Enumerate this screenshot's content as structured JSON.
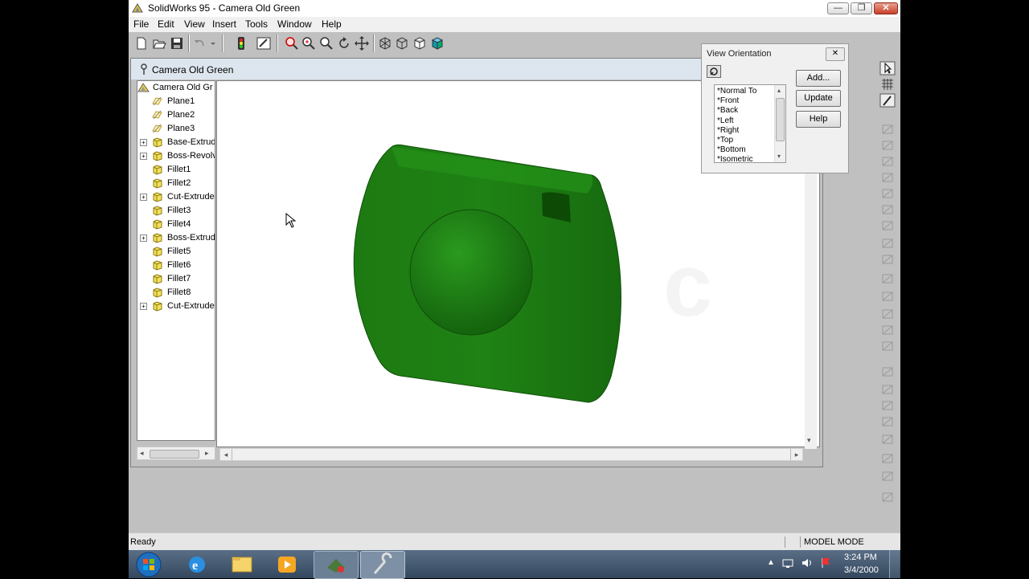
{
  "app_title": "SolidWorks 95 - Camera Old Green",
  "window_controls": {
    "minimize": "—",
    "maximize": "❐",
    "close": "✕"
  },
  "menu": [
    "File",
    "Edit",
    "View",
    "Insert",
    "Tools",
    "Window",
    "Help"
  ],
  "toolbar_icons": [
    "new-icon",
    "open-icon",
    "save-icon",
    "undo-icon",
    "undo-dropdown-icon",
    "rebuild-icon",
    "edit-sketch-icon",
    "zoom-to-fit-icon",
    "zoom-in-icon",
    "zoom-area-icon",
    "rotate-icon",
    "pan-icon",
    "wireframe-icon",
    "hidden-lines-icon",
    "hidden-removed-icon",
    "shaded-icon"
  ],
  "document": {
    "title": "Camera Old Green",
    "tree": [
      {
        "label": "Camera Old Gr",
        "expand": false,
        "type": "part",
        "root": true
      },
      {
        "label": "Plane1",
        "expand": false,
        "type": "plane"
      },
      {
        "label": "Plane2",
        "expand": false,
        "type": "plane"
      },
      {
        "label": "Plane3",
        "expand": false,
        "type": "plane"
      },
      {
        "label": "Base-Extrud",
        "expand": true,
        "type": "feature"
      },
      {
        "label": "Boss-Revolv",
        "expand": true,
        "type": "feature"
      },
      {
        "label": "Fillet1",
        "expand": false,
        "type": "feature"
      },
      {
        "label": "Fillet2",
        "expand": false,
        "type": "feature"
      },
      {
        "label": "Cut-Extrude",
        "expand": true,
        "type": "feature"
      },
      {
        "label": "Fillet3",
        "expand": false,
        "type": "feature"
      },
      {
        "label": "Fillet4",
        "expand": false,
        "type": "feature"
      },
      {
        "label": "Boss-Extrud",
        "expand": true,
        "type": "feature"
      },
      {
        "label": "Fillet5",
        "expand": false,
        "type": "feature"
      },
      {
        "label": "Fillet6",
        "expand": false,
        "type": "feature"
      },
      {
        "label": "Fillet7",
        "expand": false,
        "type": "feature"
      },
      {
        "label": "Fillet8",
        "expand": false,
        "type": "feature"
      },
      {
        "label": "Cut-Extrude",
        "expand": true,
        "type": "feature"
      }
    ],
    "model_color": "#1f7a12"
  },
  "view_orientation": {
    "title": "View Orientation",
    "close": "✕",
    "items": [
      "*Normal To",
      "*Front",
      "*Back",
      "*Left",
      "*Right",
      "*Top",
      "*Bottom",
      "*Isometric"
    ],
    "buttons": {
      "add": "Add...",
      "update": "Update",
      "help": "Help"
    }
  },
  "right_toolbar_icons": [
    "select-icon",
    "grid-icon",
    "sketch-icon",
    "line-icon",
    "rectangle-icon",
    "circle-icon",
    "arc-icon",
    "centerpoint-arc-icon",
    "spline-icon",
    "point-icon",
    "centerline-icon",
    "construction-icon",
    "extrude-icon",
    "revolve-icon",
    "fillet-icon",
    "chamfer-icon",
    "shell-icon",
    "dimension-icon",
    "relation-icon",
    "mirror-icon",
    "offset-icon",
    "convert-icon",
    "trim-icon",
    "pattern-icon",
    "more-icon"
  ],
  "status": {
    "text": "Ready",
    "mode": "MODEL MODE"
  },
  "taskbar": {
    "time": "3:24 PM",
    "date": "3/4/2000",
    "apps": [
      "start-orb",
      "internet-explorer-icon",
      "file-explorer-icon",
      "media-player-icon",
      "camera-app-icon",
      "solidworks-icon"
    ]
  }
}
